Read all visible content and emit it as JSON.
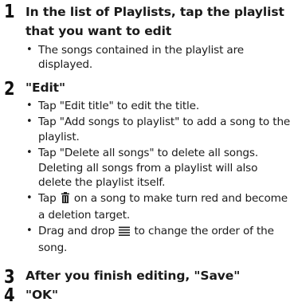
{
  "steps": [
    {
      "number": "1",
      "heading": "In the list of Playlists, tap the playlist that you want to edit",
      "bullets": [
        "The songs contained in the playlist are displayed."
      ]
    },
    {
      "number": "2",
      "heading": "\"Edit\"",
      "bullets": [
        "Tap \"Edit title\" to edit the title.",
        "Tap \"Add songs to playlist\" to add a song to the playlist.",
        "Tap \"Delete all songs\" to delete all songs. Deleting all songs from a playlist will also delete the playlist itself."
      ],
      "trash_bullet": {
        "before": "Tap ",
        "after": " on a song to make turn red and become a deletion target."
      },
      "drag_bullet": {
        "before": "Drag and drop ",
        "after": " to change the order of the song."
      },
      "icons": [
        "trash-icon",
        "drag-handle-icon"
      ]
    },
    {
      "number": "3",
      "heading": "After you finish editing, \"Save\""
    },
    {
      "number": "4",
      "heading": "\"OK\""
    }
  ]
}
